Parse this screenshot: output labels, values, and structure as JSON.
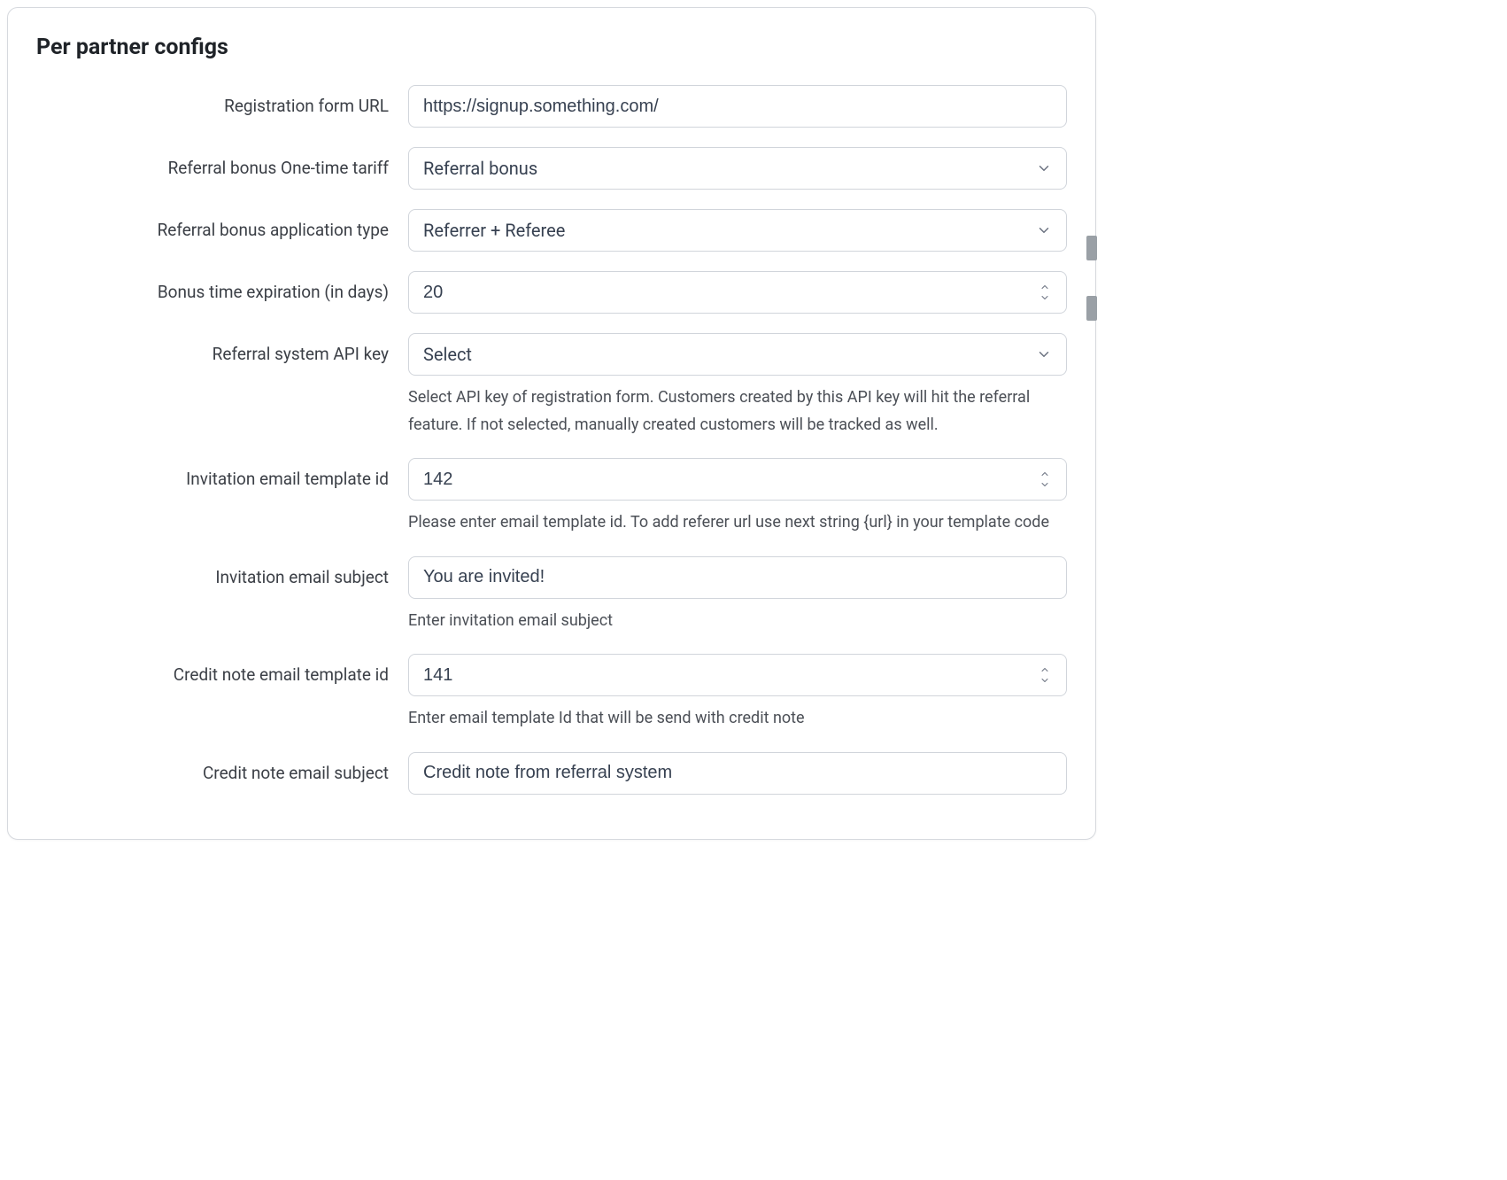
{
  "section": {
    "title": "Per partner configs"
  },
  "fields": {
    "reg_url": {
      "label": "Registration form URL",
      "value": "https://signup.something.com/"
    },
    "bonus_tariff": {
      "label": "Referral bonus One-time tariff",
      "value": "Referral bonus"
    },
    "bonus_app": {
      "label": "Referral bonus application type",
      "value": "Referrer + Referee"
    },
    "bonus_exp": {
      "label": "Bonus time expiration (in days)",
      "value": "20"
    },
    "api_key": {
      "label": "Referral system API key",
      "value": "Select",
      "help": "Select API key of registration form. Customers created by this API key will hit the referral feature. If not selected, manually created customers will be tracked as well."
    },
    "inv_tpl": {
      "label": "Invitation email template id",
      "value": "142",
      "help": "Please enter email template id. To add referer url use next string {url} in your template code"
    },
    "inv_subj": {
      "label": "Invitation email subject",
      "value": "You are invited!",
      "help": "Enter invitation email subject"
    },
    "cn_tpl": {
      "label": "Credit note email template id",
      "value": "141",
      "help": "Enter email template Id that will be send with credit note"
    },
    "cn_subj": {
      "label": "Credit note email subject",
      "value": "Credit note from referral system"
    }
  }
}
